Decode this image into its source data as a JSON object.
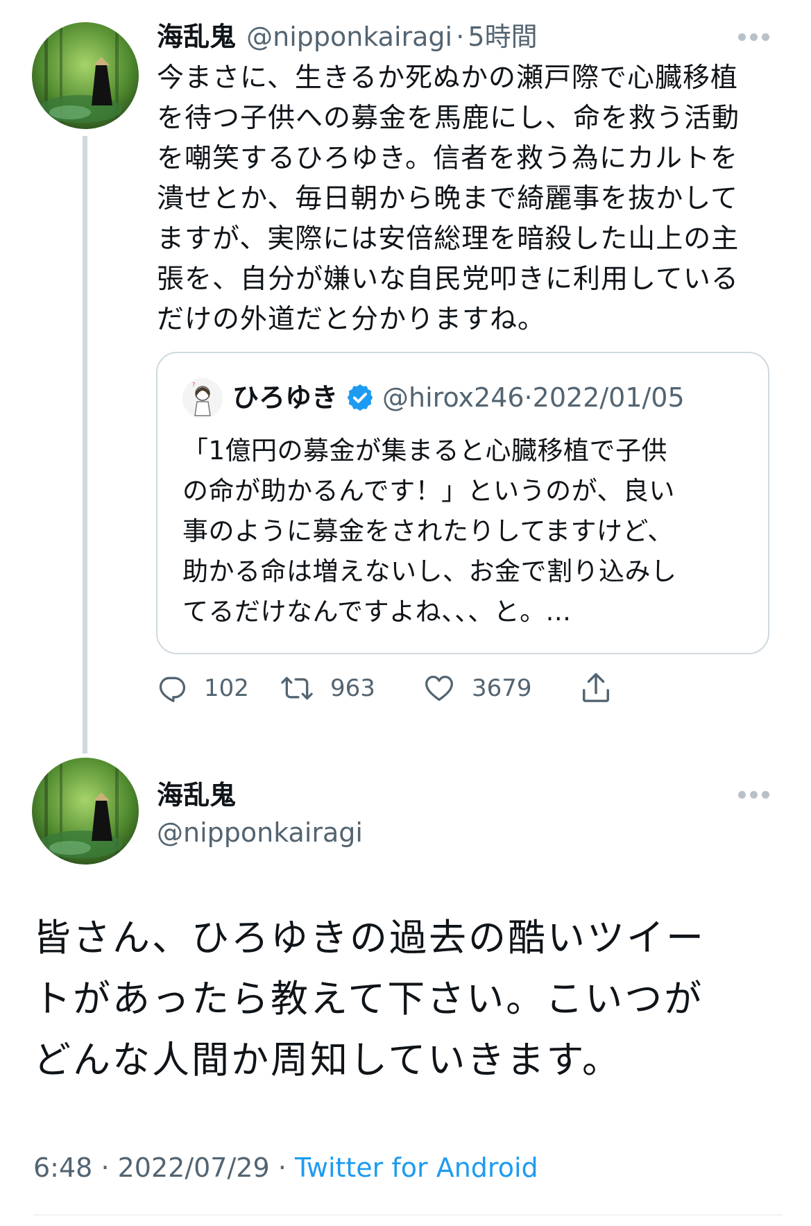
{
  "tweet1": {
    "display_name": "海乱鬼",
    "handle": "@nipponkairagi",
    "separator": "·",
    "time": "5時間",
    "body": "今まさに、生きるか死ぬかの瀬戸際で心臓移植\nを待つ子供への募金を馬鹿にし、命を救う活動\nを嘲笑するひろゆき。信者を救う為にカルトを\n潰せとか、毎日朝から晩まで綺麗事を抜かして\nますが、実際には安倍総理を暗殺した山上の主\n張を、自分が嫌いな自民党叩きに利用している\nだけの外道だと分かりますね。",
    "avatar_icon": "forest-monk-avatar",
    "more_icon": "more-horizontal-icon",
    "quote": {
      "display_name": "ひろゆき",
      "verified_icon": "verified-badge-icon",
      "handle": "@hirox246",
      "separator": "·",
      "date": "2022/01/05",
      "body": "「1億円の募金が集まると心臓移植で子供\nの命が助かるんです！」というのが、良い\n事のように募金をされたりしてますけど、\n助かる命は増えないし、お金で割り込みし\nてるだけなんですよね、、、と。...",
      "avatar_icon": "cartoon-character-avatar"
    },
    "actions": {
      "reply_count": "102",
      "retweet_count": "963",
      "like_count": "3679",
      "reply_icon": "reply-icon",
      "retweet_icon": "retweet-icon",
      "like_icon": "heart-icon",
      "share_icon": "share-icon"
    }
  },
  "tweet2": {
    "display_name": "海乱鬼",
    "handle": "@nipponkairagi",
    "body": "皆さん、ひろゆきの過去の酷いツイー\nトがあったら教えて下さい。こいつが\nどんな人間か周知していきます。",
    "time": "6:48",
    "separator": "·",
    "date": "2022/07/29",
    "separator2": "·",
    "source": "Twitter for Android"
  },
  "colors": {
    "text": "#0f1419",
    "secondary": "#536471",
    "link": "#1d9bf0",
    "border": "#cfd9de"
  }
}
